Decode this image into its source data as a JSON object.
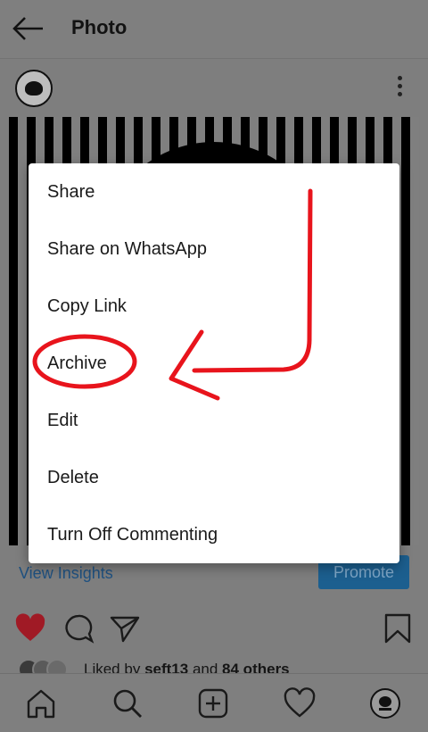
{
  "header": {
    "title": "Photo"
  },
  "post": {
    "insights_link": "View Insights",
    "promote_label": "Promote"
  },
  "likes": {
    "prefix": "Liked by",
    "user": "seft13",
    "connector": "and",
    "others": "84 others"
  },
  "menu": {
    "items": [
      {
        "label": "Share"
      },
      {
        "label": "Share on WhatsApp"
      },
      {
        "label": "Copy Link"
      },
      {
        "label": "Archive"
      },
      {
        "label": "Edit"
      },
      {
        "label": "Delete"
      },
      {
        "label": "Turn Off Commenting"
      }
    ]
  },
  "colors": {
    "scrim": "#7e7e7e",
    "heart": "#a01a25",
    "annotation": "#e8141c",
    "promote_button": "#1c5f8f"
  },
  "icons": {
    "back": "back-arrow-icon",
    "more": "more-vertical-icon",
    "like": "heart-filled-icon",
    "comment": "comment-icon",
    "share": "send-icon",
    "save": "bookmark-icon",
    "home": "home-icon",
    "search": "search-icon",
    "add": "add-post-icon",
    "activity": "heart-outline-icon",
    "profile": "profile-avatar-icon"
  }
}
